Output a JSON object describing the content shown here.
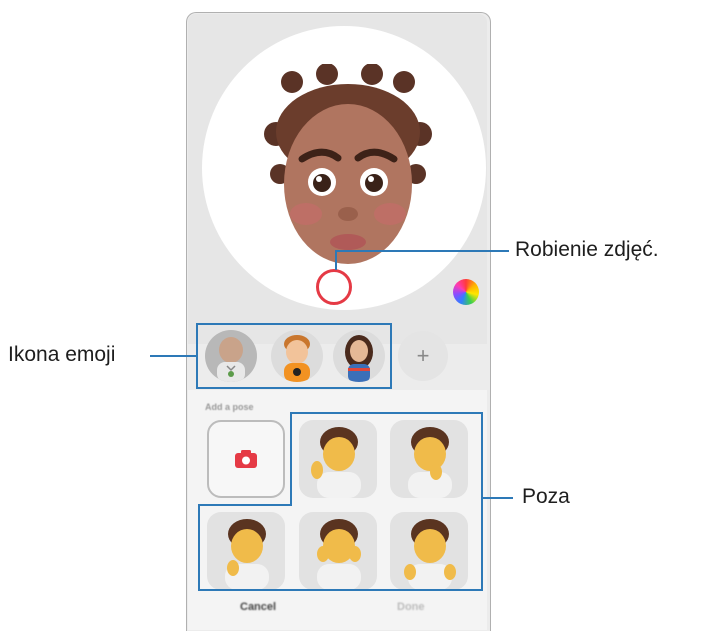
{
  "preview": {
    "capture_icon": "shutter-ring-icon",
    "color_icon": "color-wheel-icon"
  },
  "emoji_list": {
    "items": [
      {
        "name": "emoji-avatar-1",
        "selected": true
      },
      {
        "name": "emoji-avatar-2",
        "selected": false
      },
      {
        "name": "emoji-avatar-3",
        "selected": false
      }
    ],
    "add_label": "+"
  },
  "pose_sheet": {
    "title": "Add a pose",
    "camera_icon": "camera-icon",
    "poses": 5
  },
  "bottom": {
    "cancel_label": "Cancel",
    "done_label": "Done"
  },
  "callouts": {
    "capture": "Robienie zdjęć.",
    "emoji": "Ikona emoji",
    "pose": "Poza"
  },
  "colors": {
    "accent": "#2d79b7",
    "capture": "#e53a45",
    "cancel_text": "#444444",
    "done_text": "#bbbbbb"
  }
}
